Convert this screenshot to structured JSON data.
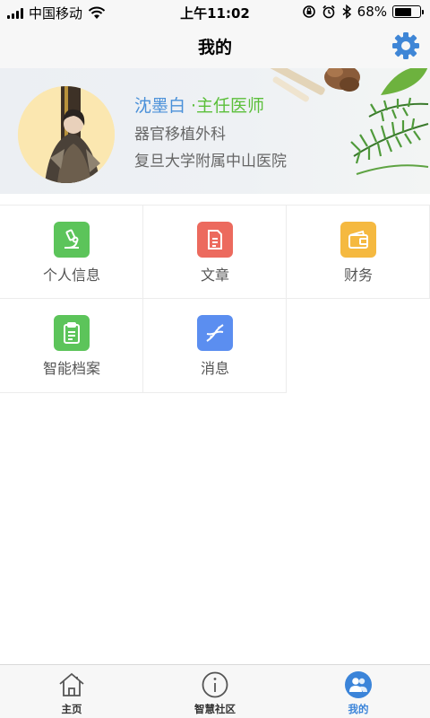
{
  "status_bar": {
    "carrier": "中国移动",
    "time": "上午11:02",
    "battery": "68%",
    "battery_level": 0.68
  },
  "header": {
    "title": "我的",
    "settings_icon": "gear-icon"
  },
  "profile": {
    "name": "沈墨白",
    "title": "·主任医师",
    "department": "器官移植外科",
    "hospital": "复旦大学附属中山医院",
    "colors": {
      "name": "#4a90d9",
      "title": "#5bbf3a"
    }
  },
  "menu": {
    "items": [
      {
        "label": "个人信息",
        "icon": "microscope-icon",
        "color": "#5cc45a"
      },
      {
        "label": "文章",
        "icon": "document-icon",
        "color": "#ec6a5e"
      },
      {
        "label": "财务",
        "icon": "wallet-icon",
        "color": "#f5b940"
      },
      {
        "label": "智能档案",
        "icon": "clipboard-icon",
        "color": "#5cc45a"
      },
      {
        "label": "消息",
        "icon": "dna-icon",
        "color": "#5b8ef0"
      }
    ]
  },
  "tab_bar": {
    "tabs": [
      {
        "label": "主页",
        "icon": "home-icon"
      },
      {
        "label": "智慧社区",
        "icon": "info-icon"
      },
      {
        "label": "我的",
        "icon": "users-icon",
        "active": true
      }
    ],
    "active_color": "#3b84d9"
  }
}
